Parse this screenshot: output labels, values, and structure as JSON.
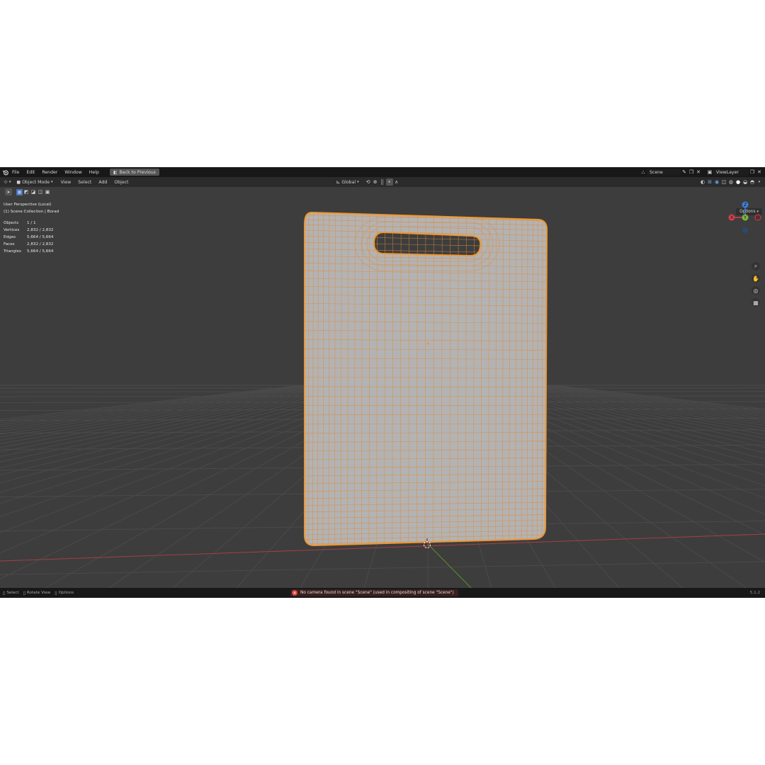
{
  "menu": [
    "File",
    "Edit",
    "Render",
    "Window",
    "Help"
  ],
  "back_button": "Back to Previous",
  "scene": {
    "name": "Scene",
    "view_layer": "ViewLayer"
  },
  "header": {
    "mode": "Object Mode",
    "menus": [
      "View",
      "Select",
      "Add",
      "Object"
    ],
    "transform_orientation": "Global",
    "options_label": "Options"
  },
  "overlay": {
    "perspective": "User Perspective (Local)",
    "collection": "(1) Scene Collection | Borad",
    "stats": [
      {
        "label": "Objects",
        "value": "1 / 1"
      },
      {
        "label": "Vertices",
        "value": "2,832 / 2,832"
      },
      {
        "label": "Edges",
        "value": "5,664 / 5,664"
      },
      {
        "label": "Faces",
        "value": "2,832 / 2,832"
      },
      {
        "label": "Triangles",
        "value": "5,664 / 5,664"
      }
    ]
  },
  "gizmo": {
    "x": "X",
    "y": "Y",
    "z": "Z"
  },
  "status": {
    "select": "Select",
    "rotate": "Rotate View",
    "options": "Options",
    "error": "No camera found in scene \"Scene\" (used in compositing of scene \"Scene\")",
    "version": "5.1.2"
  },
  "colors": {
    "selection": "#f0962d",
    "mesh_face": "#b3b3b3",
    "x_axis": "#d04050",
    "y_axis": "#7eb33a",
    "z_axis": "#3f7fd6",
    "active_tool": "#4673c4"
  }
}
